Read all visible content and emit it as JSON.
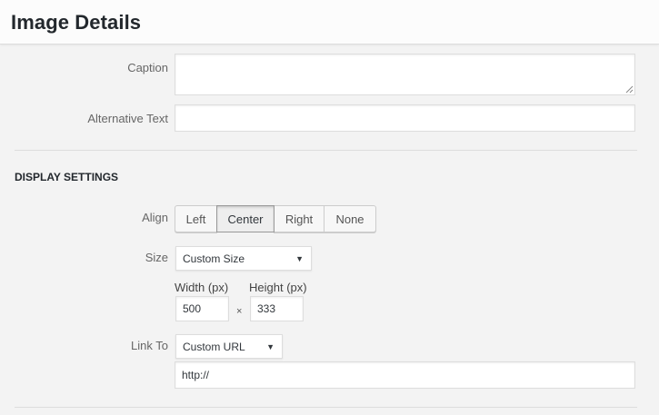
{
  "header": {
    "title": "Image Details"
  },
  "fields": {
    "caption": {
      "label": "Caption",
      "value": ""
    },
    "alt_text": {
      "label": "Alternative Text",
      "value": ""
    }
  },
  "display_settings": {
    "title": "DISPLAY SETTINGS",
    "align": {
      "label": "Align",
      "options": [
        "Left",
        "Center",
        "Right",
        "None"
      ],
      "selected": "Center"
    },
    "size": {
      "label": "Size",
      "selected": "Custom Size",
      "width_label": "Width (px)",
      "height_label": "Height (px)",
      "width_value": "500",
      "height_value": "333",
      "separator": "×"
    },
    "link_to": {
      "label": "Link To",
      "selected": "Custom URL",
      "url_value": "http://"
    }
  },
  "icons": {
    "dropdown": "chevron-down-icon",
    "resize": "resize-grip-icon"
  }
}
